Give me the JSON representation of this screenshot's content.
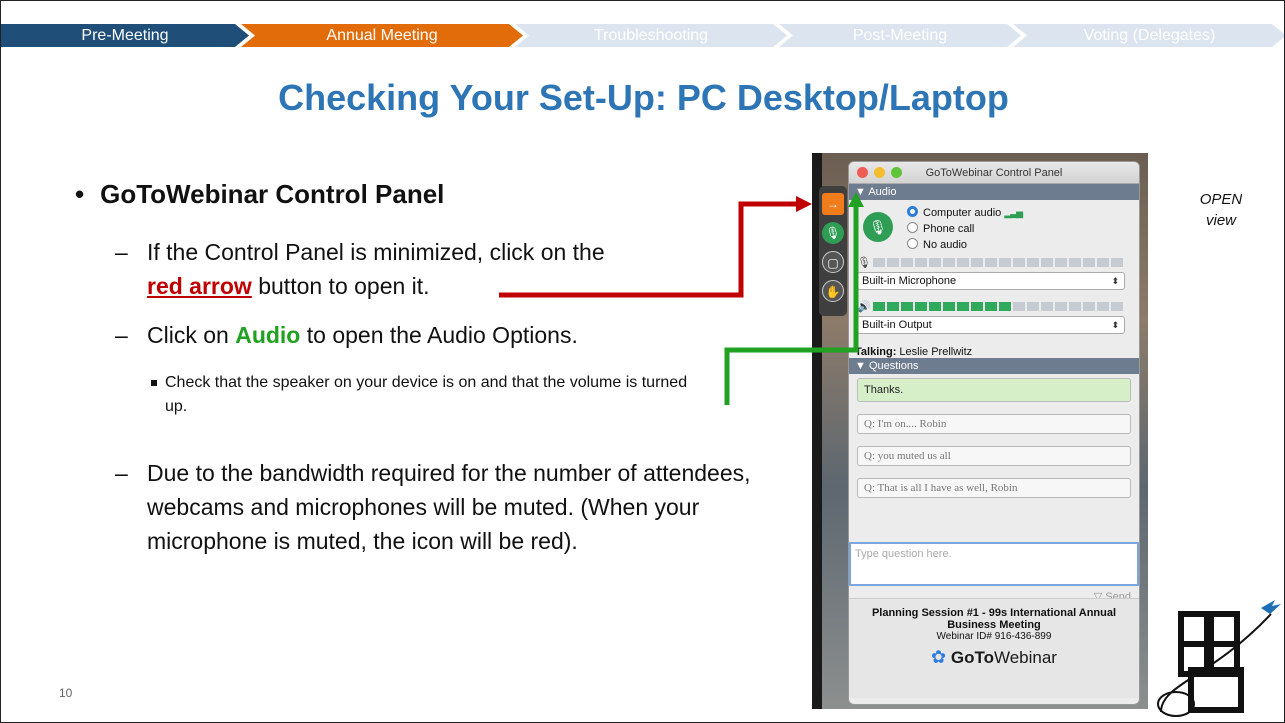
{
  "progress": {
    "steps": [
      "Pre-Meeting",
      "Annual Meeting",
      "Troubleshooting",
      "Post-Meeting",
      "Voting (Delegates)"
    ],
    "active": "Annual Meeting"
  },
  "slide": {
    "title": "Checking Your Set-Up: PC Desktop/Laptop",
    "bullet_main": "GoToWebinar Control Panel",
    "sub1_pre": "If the Control Panel is minimized, click on the",
    "sub1_link": "red arrow",
    "sub1_post": " button to open it.",
    "sub2_pre": "Click on ",
    "sub2_word": "Audio",
    "sub2_post": " to open the Audio Options.",
    "subsub": "Check that the speaker on your device is on and that the volume is turned up.",
    "sub3": "Due to the bandwidth required for the number of attendees, webcams and microphones will be muted. (When your microphone is muted, the icon will be red).",
    "open_view": "OPEN view",
    "page_number": "10"
  },
  "panel": {
    "window_title": "GoToWebinar Control Panel",
    "audio_header": "Audio",
    "radio_computer": "Computer audio",
    "radio_phone": "Phone call",
    "radio_none": "No audio",
    "mic_device": "Built-in Microphone",
    "output_device": "Built-in Output",
    "talking_label": "Talking:",
    "talking_name": "Leslie Prellwitz",
    "questions_header": "Questions",
    "q_thanks": "Thanks.",
    "q1": "Q: I'm on.... Robin",
    "q2": "Q: you muted us all",
    "q3": "Q: That is all I have as well, Robin",
    "input_placeholder": "Type question here.",
    "send_label": "Send",
    "session_title": "Planning Session #1 - 99s International Annual Business Meeting",
    "webinar_id": "Webinar ID# 916-436-899",
    "brand_goto": "GoTo",
    "brand_webinar": "Webinar"
  },
  "colors": {
    "title": "#2e75b6",
    "arrow_red": "#c00000",
    "arrow_green": "#21a121",
    "progress_active": "#e36c0a",
    "progress_done": "#1f4e79"
  }
}
